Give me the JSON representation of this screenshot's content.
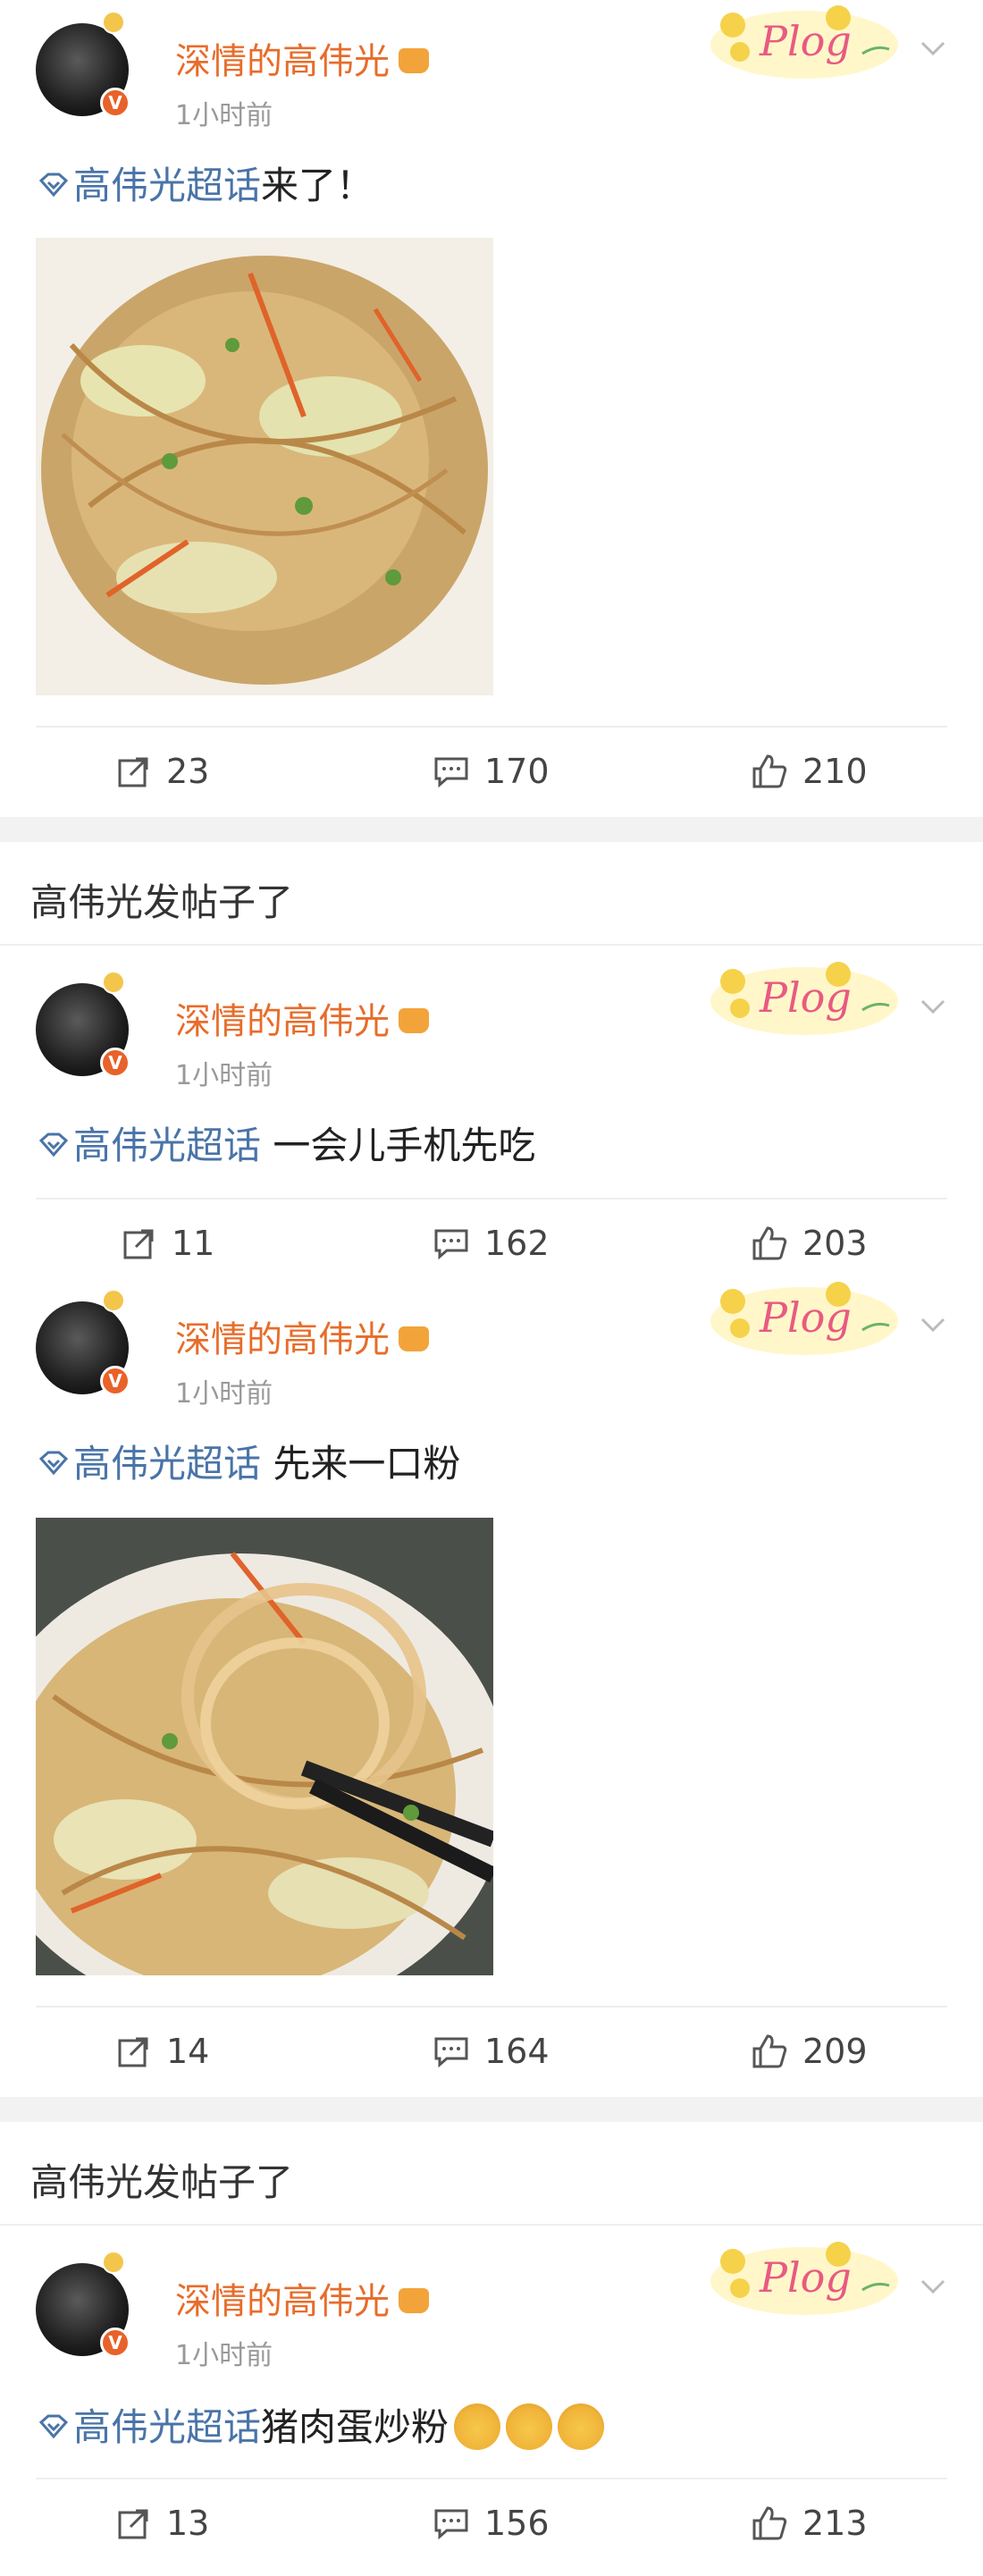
{
  "posts": [
    {
      "username": "深情的高伟光",
      "time": "1小时前",
      "topic": "高伟光超话",
      "text": "来了！",
      "has_photo": true,
      "repost": "23",
      "comment": "170",
      "like": "210"
    },
    {
      "username": "深情的高伟光",
      "time": "1小时前",
      "topic": "高伟光超话",
      "text": " 一会儿手机先吃",
      "has_photo": false,
      "repost": "11",
      "comment": "162",
      "like": "203"
    },
    {
      "username": "深情的高伟光",
      "time": "1小时前",
      "topic": "高伟光超话",
      "text": " 先来一口粉",
      "has_photo": true,
      "repost": "14",
      "comment": "164",
      "like": "209"
    },
    {
      "username": "深情的高伟光",
      "time": "1小时前",
      "topic": "高伟光超话",
      "text": "猪肉蛋炒粉",
      "has_photo": false,
      "repost": "13",
      "comment": "156",
      "like": "213"
    }
  ],
  "section_titles": [
    "高伟光发帖子了",
    "高伟光发帖子了"
  ],
  "plog_label": "Plog",
  "colors": {
    "username": "#e86c2a",
    "topic": "#4a74a8",
    "gap": "#f2f2f2"
  },
  "icons": [
    "repost-icon",
    "comment-icon",
    "like-icon",
    "chevron-down-icon",
    "verified-icon"
  ]
}
